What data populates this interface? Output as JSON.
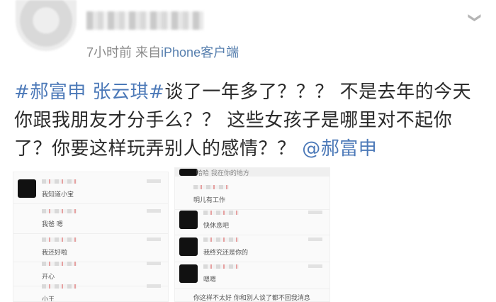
{
  "header": {
    "meta_time": "7小时前",
    "meta_from": "来自",
    "meta_source": "iPhone客户端"
  },
  "post": {
    "tag": "#郝富申 张云琪#",
    "body": "谈了一年多了？？？ 不是去年的今天你跟我朋友才分手么？？ 这些女孩子是哪里对不起你了？你要这样玩弄别人的感情？？ ",
    "mention": "@郝富申"
  },
  "shots": {
    "left": [
      {
        "message": "我知道小宝"
      },
      {
        "message": "我爸 嗯"
      },
      {
        "message": "我还好啦"
      },
      {
        "message": "开心"
      },
      {
        "message": "小王"
      }
    ],
    "right": [
      {
        "message": "哈哈 我在你的地方"
      },
      {
        "message": "明儿有工作"
      },
      {
        "message": "快休息吧"
      },
      {
        "message": "我终究还是你的"
      },
      {
        "message": "嗯嗯"
      },
      {
        "message": "你这样不太好 你和别人谈了都不回我消息"
      }
    ]
  }
}
